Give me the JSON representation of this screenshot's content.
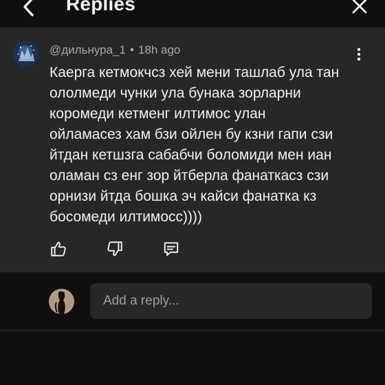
{
  "header": {
    "title": "Replies",
    "back_icon": "chevron-left-icon",
    "close_icon": "close-icon"
  },
  "comment": {
    "author": "@дильнура_1",
    "separator": "•",
    "time": "18h ago",
    "text": "Каерга кетмокчсз хей мени ташлаб ула тан\nололмеди чунки ула бунака зорларни\nкоромеди кетменг илтимос улан\nойламасез хам бзи ойлен бу кзни гапи сзи\nйтдан кетшзга сабабчи боломиди мен иан\nоламан сз енг зор йтберла фанаткасз сзи\nорнизи йтда бошка эч кайси фанатка кз\nбосомеди илтимосс))))",
    "more_icon": "more-vertical-icon",
    "actions": {
      "like_icon": "thumbs-up-icon",
      "dislike_icon": "thumbs-down-icon",
      "reply_icon": "comment-icon"
    }
  },
  "reply": {
    "placeholder": "Add a reply..."
  },
  "colors": {
    "background": "#0f0f0f",
    "card": "#272727",
    "text": "#f1f1f1",
    "secondary_text": "#aaaaaa"
  }
}
